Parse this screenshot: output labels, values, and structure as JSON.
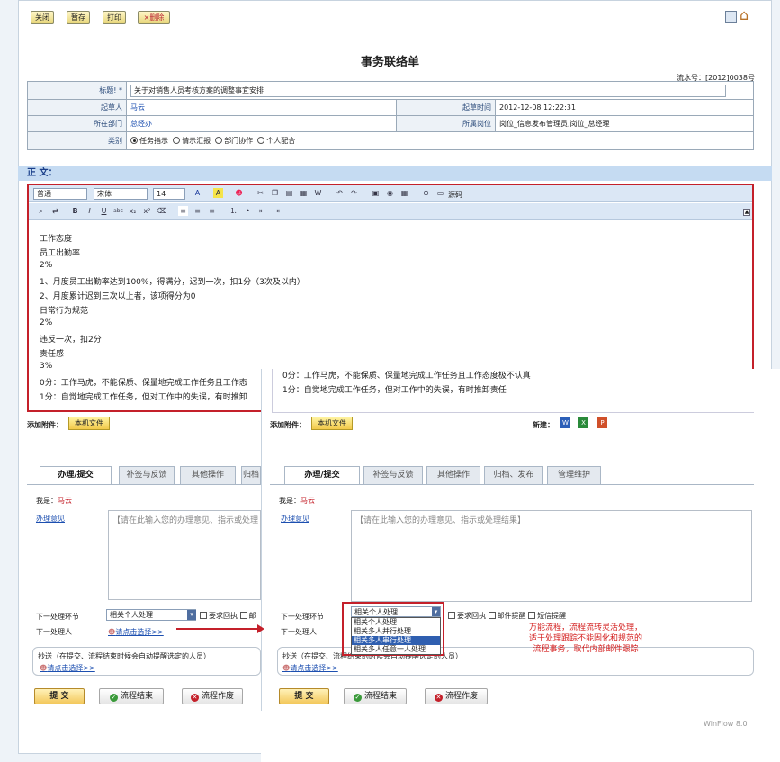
{
  "toolbar": {
    "close": "关闭",
    "save": "暂存",
    "print": "打印",
    "delete": "×删除"
  },
  "form": {
    "title": "事务联络单",
    "serial": "流水号：[2012]0038号",
    "title_label": "标题! *",
    "title_value": "关于对销售人员考核方案的调整事宜安排",
    "creator_label": "起草人",
    "creator_value": "马云",
    "time_label": "起草时间",
    "time_value": "2012-12-08 12:22:31",
    "dept_label": "所在部门",
    "dept_value": "总经办",
    "post_label": "所属岗位",
    "post_value": "岗位_信息发布管理员,岗位_总经理",
    "type_label": "类别",
    "types": [
      "任务指示",
      "请示汇报",
      "部门协作",
      "个人配合"
    ]
  },
  "body_section": "正  文：",
  "editor": {
    "format": "普通",
    "font": "宋体",
    "size": "14",
    "source": "源码"
  },
  "content_lines": [
    "工作态度",
    "员工出勤率",
    "2%",
    "1、月度员工出勤率达到100%，得满分，迟到一次，扣1分（3次及以内）",
    "2、月度累计迟到三次以上者，该项得分为0",
    "日常行为规范",
    "2%",
    "违反一次，扣2分",
    "责任感",
    "3%",
    "0分：工作马虎，不能保质、保量地完成工作任务且工作态",
    "1分：自觉地完成工作任务，但对工作中的失误，有时推卸"
  ],
  "overlay_lines": [
    "0分：工作马虎，不能保质、保量地完成工作任务且工作态度极不认真",
    "1分：自觉地完成工作任务，但对工作中的失误，有时推卸责任"
  ],
  "attach_label": "添加附件：",
  "attach_btn": "本机文件",
  "new_label": "新建：",
  "left": {
    "tabs": [
      "办理/提交",
      "补签与反馈",
      "其他操作",
      "归档"
    ],
    "me": "我是：",
    "me_name": "马云",
    "opinion_label": "办理意见",
    "opinion_placeholder": "【请在此输入您的办理意见、指示或处理",
    "next_step_label": "下一处理环节",
    "next_step_value": "相关个人处理",
    "receipt": "要求回执",
    "mail": "邮",
    "next_person_label": "下一处理人",
    "click_select": "请点击选择>>",
    "cc_label": "抄送（在提交、流程结束时候会自动提醒选定的人员）",
    "submit": "提 交",
    "finish": "流程结束",
    "void": "流程作废"
  },
  "right": {
    "tabs": [
      "办理/提交",
      "补签与反馈",
      "其他操作",
      "归档、发布",
      "管理维护"
    ],
    "me": "我是：",
    "me_name": "马云",
    "opinion_label": "办理意见",
    "opinion_placeholder": "【请在此输入您的办理意见、指示或处理结果】",
    "next_step_label": "下一处理环节",
    "next_step_value": "相关个人处理",
    "receipt": "要求回执",
    "mail": "邮件提醒",
    "sms": "短信提醒",
    "next_person_label": "下一处理人",
    "options": [
      "相关个人处理",
      "相关多人并行处理",
      "相关多人串行处理",
      "相关多人任意一人处理"
    ],
    "cc_label": "抄送（在提交、流程结束的时候会自动提醒选定的人员）",
    "click_select": "请点击选择>>",
    "submit": "提 交",
    "finish": "流程结束",
    "void": "流程作废"
  },
  "annotation": [
    "万能流程，流程流转灵活处理，",
    "适于处理跟踪不能固化和规范的",
    "流程事务，取代内部邮件跟踪"
  ],
  "footer": "WinFlow 8.0",
  "colors": {
    "accent_red": "#c4202a",
    "section_bg": "#c5dbf2",
    "link_blue": "#1c4fb0"
  }
}
